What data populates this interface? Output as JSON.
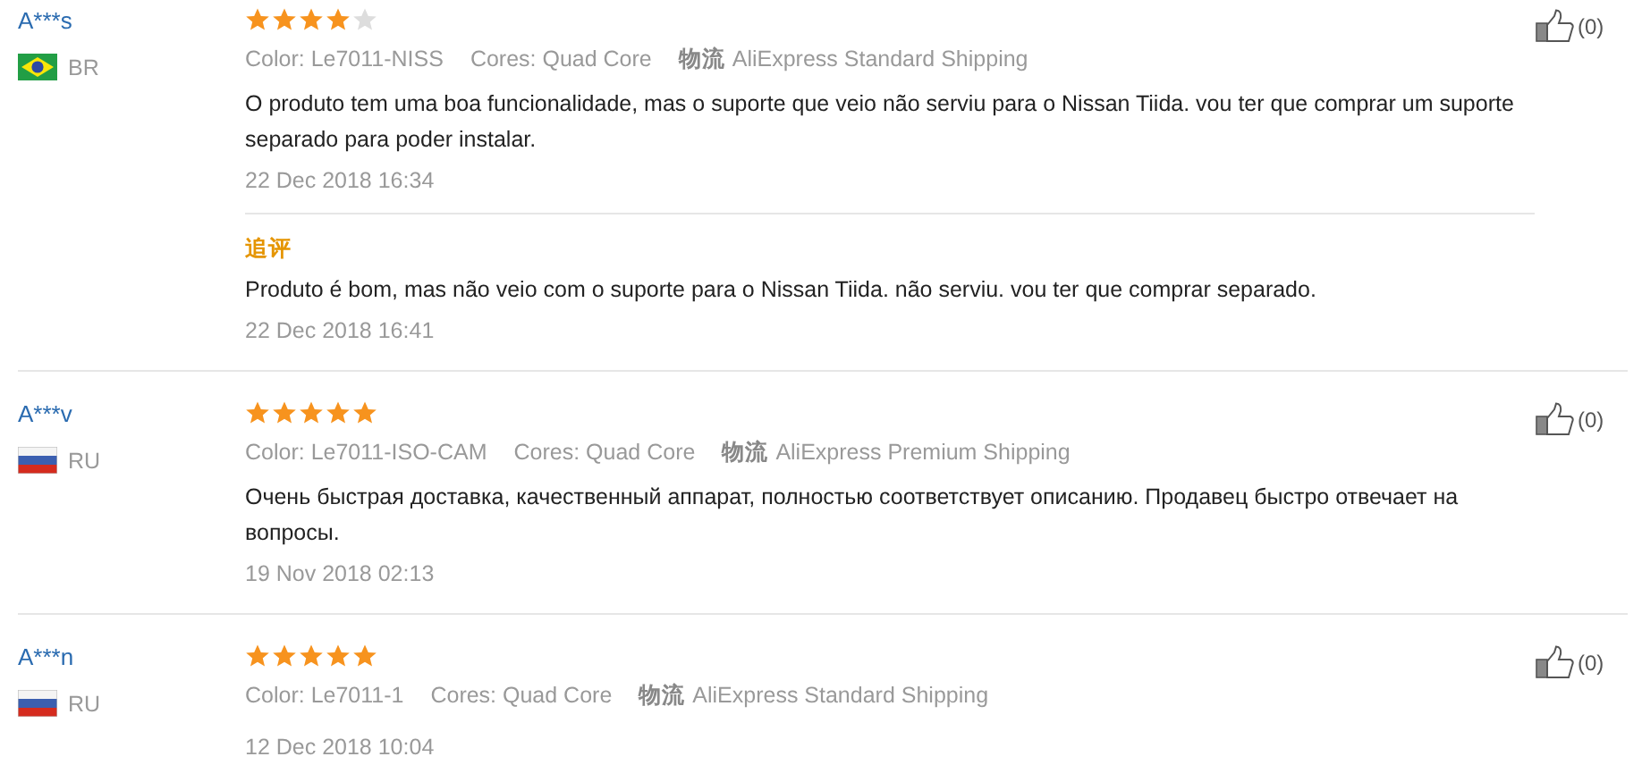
{
  "reviews": [
    {
      "user": "A***s",
      "kind": "brazil",
      "country": "BR",
      "stars": 4,
      "meta": [
        {
          "kind": "plain",
          "text": "Color: Le7011-NISS"
        },
        {
          "kind": "plain",
          "text": "Cores: Quad Core"
        },
        {
          "kind": "shipping",
          "label": "物流",
          "text": "AliExpress Standard Shipping"
        }
      ],
      "text": "O produto tem uma boa funcionalidade, mas o suporte que veio não serviu para o Nissan Tiida. vou ter que comprar um suporte separado para poder instalar.",
      "date": "22 Dec 2018 16:34",
      "likes": "(0)",
      "followup": {
        "label": "追评",
        "text": "Produto é bom, mas não veio com o suporte para o Nissan Tiida. não serviu. vou ter que comprar separado.",
        "date": "22 Dec 2018 16:41"
      }
    },
    {
      "user": "A***v",
      "kind": "russia",
      "country": "RU",
      "stars": 5,
      "meta": [
        {
          "kind": "plain",
          "text": "Color: Le7011-ISO-CAM"
        },
        {
          "kind": "plain",
          "text": "Cores: Quad Core"
        },
        {
          "kind": "shipping",
          "label": "物流",
          "text": "AliExpress Premium Shipping"
        }
      ],
      "text": "Очень быстрая доставка, качественный аппарат, полностью соответствует описанию. Продавец быстро отвечает на вопросы.",
      "date": "19 Nov 2018 02:13",
      "likes": "(0)"
    },
    {
      "user": "A***n",
      "kind": "russia",
      "country": "RU",
      "stars": 5,
      "meta": [
        {
          "kind": "plain",
          "text": "Color: Le7011-1"
        },
        {
          "kind": "plain",
          "text": "Cores: Quad Core"
        },
        {
          "kind": "shipping",
          "label": "物流",
          "text": "AliExpress Standard Shipping"
        }
      ],
      "date": "12 Dec 2018 10:04",
      "likes": "(0)"
    }
  ]
}
